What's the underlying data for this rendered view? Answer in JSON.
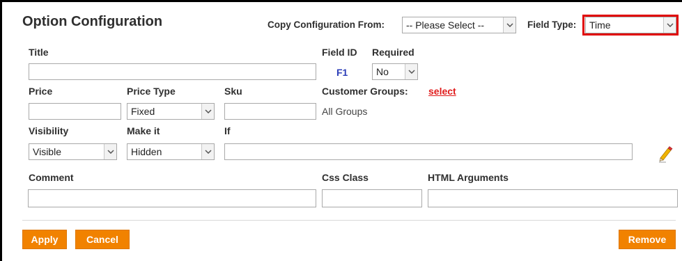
{
  "header": {
    "title": "Option Configuration",
    "copy_label": "Copy Configuration From:",
    "copy_value": "-- Please Select --",
    "field_type_label": "Field Type:",
    "field_type_value": "Time"
  },
  "form": {
    "title_label": "Title",
    "title_value": "",
    "field_id_label": "Field ID",
    "field_id_value": "F1",
    "required_label": "Required",
    "required_value": "No",
    "price_label": "Price",
    "price_value": "",
    "price_type_label": "Price Type",
    "price_type_value": "Fixed",
    "sku_label": "Sku",
    "sku_value": "",
    "customer_groups_label": "Customer Groups:",
    "customer_groups_link": "select",
    "customer_groups_value": "All Groups",
    "visibility_label": "Visibility",
    "visibility_value": "Visible",
    "make_it_label": "Make it",
    "make_it_value": "Hidden",
    "if_label": "If",
    "if_value": "",
    "comment_label": "Comment",
    "comment_value": "",
    "css_class_label": "Css Class",
    "css_class_value": "",
    "html_args_label": "HTML Arguments",
    "html_args_value": ""
  },
  "buttons": {
    "apply": "Apply",
    "cancel": "Cancel",
    "remove": "Remove"
  },
  "colors": {
    "button_orange": "#f18200",
    "field_id_blue": "#2d3fb8",
    "link_red": "#e01b1b",
    "highlight_red": "#e00000"
  },
  "icons": {
    "edit": "pencil-icon",
    "dropdown": "chevron-down-icon"
  }
}
